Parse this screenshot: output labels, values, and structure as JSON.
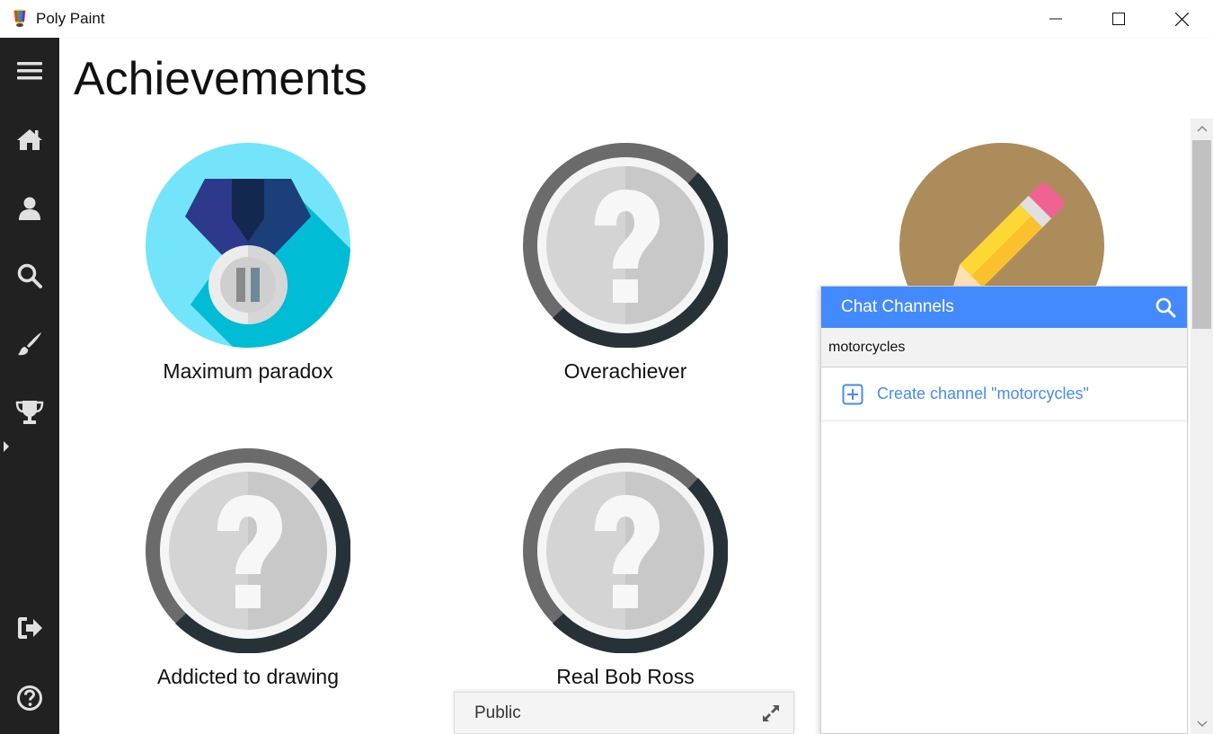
{
  "window": {
    "title": "Poly Paint",
    "controls": [
      "minimize-icon",
      "maximize-icon",
      "close-icon"
    ]
  },
  "sidebar": {
    "items": [
      {
        "name": "menu",
        "icon": "hamburger-menu-icon"
      },
      {
        "name": "home",
        "icon": "home-icon"
      },
      {
        "name": "profile",
        "icon": "user-icon"
      },
      {
        "name": "search",
        "icon": "search-icon"
      },
      {
        "name": "draw",
        "icon": "paintbrush-icon"
      },
      {
        "name": "achievements",
        "icon": "trophy-icon",
        "active": true
      },
      {
        "name": "logout",
        "icon": "logout-icon"
      },
      {
        "name": "help",
        "icon": "help-icon"
      }
    ]
  },
  "header": {
    "title": "Achievements"
  },
  "achievements": [
    {
      "label": "Maximum paradox",
      "icon": "medal-icon",
      "unlocked": true
    },
    {
      "label": "Overachiever",
      "icon": "question-mark-icon",
      "unlocked": false
    },
    {
      "label": "",
      "icon": "pencil-icon",
      "unlocked": true
    },
    {
      "label": "Addicted to drawing",
      "icon": "question-mark-icon",
      "unlocked": false
    },
    {
      "label": "Real Bob Ross",
      "icon": "question-mark-icon",
      "unlocked": false
    }
  ],
  "chat": {
    "title": "Chat Channels",
    "search_value": "motorcycles",
    "create_label": "Create channel \"motorcycles\""
  },
  "public_chat": {
    "label": "Public"
  },
  "colors": {
    "sidebar_bg": "#212121",
    "accent": "#448aff",
    "locked_badge": "#cfcfcf",
    "medal_bg": "#74e4fb",
    "pencil_bg": "#ad8c5c"
  }
}
